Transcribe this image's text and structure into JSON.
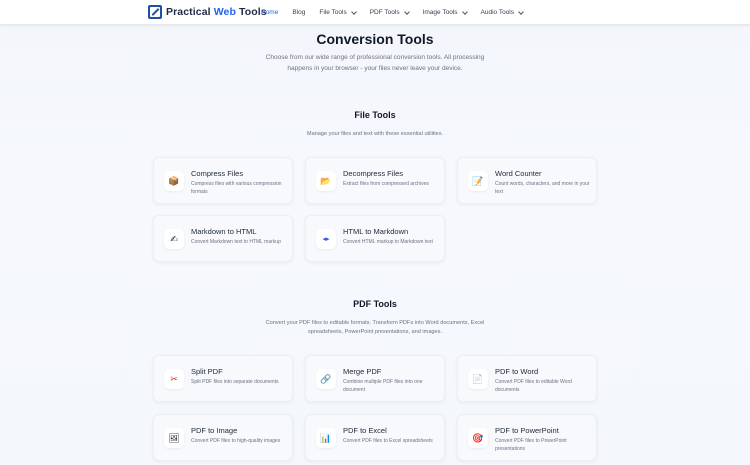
{
  "nav": {
    "brand_prefix": "Practical ",
    "brand_accent": "Web",
    "brand_suffix": " Tools",
    "links": [
      {
        "label": "Home",
        "active": true
      },
      {
        "label": "Blog"
      },
      {
        "label": "File Tools",
        "dropdown": true
      },
      {
        "label": "PDF Tools",
        "dropdown": true
      },
      {
        "label": "Image Tools",
        "dropdown": true
      },
      {
        "label": "Audio Tools",
        "dropdown": true
      }
    ]
  },
  "hero": {
    "title": "Conversion Tools",
    "subtitle": "Choose from our wide range of professional conversion tools. All processing happens in your browser - your files never leave your device."
  },
  "file_tools": {
    "title": "File Tools",
    "desc": "Manage your files and text with these essential utilities.",
    "cards": [
      {
        "title": "Compress Files",
        "desc": "Compress files with various compression formats",
        "icon": "📦",
        "icon_name": "package-icon"
      },
      {
        "title": "Decompress Files",
        "desc": "Extract files from compressed archives",
        "icon": "📂",
        "icon_name": "folder-open-icon"
      },
      {
        "title": "Word Counter",
        "desc": "Count words, characters, and more in your text",
        "icon": "📝",
        "icon_name": "memo-icon"
      },
      {
        "title": "Markdown to HTML",
        "desc": "Convert Markdown text to HTML markup",
        "icon": "✍",
        "icon_name": "writing-hand-icon"
      },
      {
        "title": "HTML to Markdown",
        "desc": "Convert HTML markup to Markdown text",
        "icon": "◂▸",
        "icon_name": "code-arrows-icon"
      }
    ]
  },
  "pdf_tools": {
    "title": "PDF Tools",
    "desc": "Convert your PDF files to editable formats. Transform PDFs into Word documents, Excel spreadsheets, PowerPoint presentations, and images.",
    "cards": [
      {
        "title": "Split PDF",
        "desc": "Split PDF files into separate documents",
        "icon": "✂",
        "icon_name": "scissors-icon"
      },
      {
        "title": "Merge PDF",
        "desc": "Combine multiple PDF files into one document",
        "icon": "🔗",
        "icon_name": "link-icon"
      },
      {
        "title": "PDF to Word",
        "desc": "Convert PDF files to editable Word documents",
        "icon": "📄",
        "icon_name": "document-icon"
      },
      {
        "title": "PDF to Image",
        "desc": "Convert PDF files to high-quality images",
        "icon": "🖼",
        "icon_name": "picture-icon"
      },
      {
        "title": "PDF to Excel",
        "desc": "Convert PDF files to Excel spreadsheets",
        "icon": "📊",
        "icon_name": "bar-chart-icon"
      },
      {
        "title": "PDF to PowerPoint",
        "desc": "Convert PDF files to PowerPoint presentations",
        "icon": "🎯",
        "icon_name": "target-icon"
      }
    ]
  }
}
